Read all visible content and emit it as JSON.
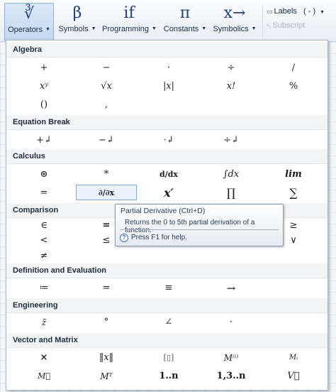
{
  "ribbon": {
    "buttons": [
      {
        "glyph": "∛",
        "label": "Operators"
      },
      {
        "glyph": "β",
        "label": "Symbols"
      },
      {
        "glyph": "if",
        "label": "Programming"
      },
      {
        "glyph": "π",
        "label": "Constants"
      },
      {
        "glyph": "x→",
        "label": "Symbolics"
      }
    ],
    "labels_label": "Labels",
    "labels_value": "( - )",
    "subscript_label": "Subscript"
  },
  "sections": [
    {
      "title": "Algebra"
    },
    {
      "title": "Equation Break"
    },
    {
      "title": "Calculus"
    },
    {
      "title": "Comparison"
    },
    {
      "title": "Definition and Evaluation"
    },
    {
      "title": "Engineering"
    },
    {
      "title": "Vector and Matrix"
    }
  ],
  "ops": {
    "algebra": [
      "+",
      "−",
      "·",
      "÷",
      "/",
      "xʸ",
      "√x",
      "|x|",
      "x!",
      "%",
      "()",
      ","
    ],
    "equation_break": [
      "+↲",
      "−↲",
      "·↲",
      "÷↲"
    ],
    "calculus": [
      "⊛",
      "*",
      "d/dx",
      "∫dx",
      "lim",
      "=",
      "∂/∂x",
      "x′",
      "∏",
      "∑"
    ],
    "comparison": [
      "∈",
      "=",
      "≥",
      "<",
      "≤",
      "∨",
      "≠"
    ],
    "definition": [
      "≔",
      "=",
      "≡",
      "→"
    ],
    "engineering": [
      "z̄",
      "°",
      "∠",
      "·"
    ],
    "vector": [
      "×",
      "‖x‖",
      "[▯]",
      "M⁽ⁱ⁾",
      "Mᵢ",
      "M⃗",
      "Mᵀ",
      "1‥n",
      "1,3‥n",
      "V⃗"
    ]
  },
  "tooltip": {
    "title": "Partial Derivative (Ctrl+D)",
    "description": "Returns the 0 to 5th partial derivation of a function.",
    "help": "Press F1 for help."
  }
}
